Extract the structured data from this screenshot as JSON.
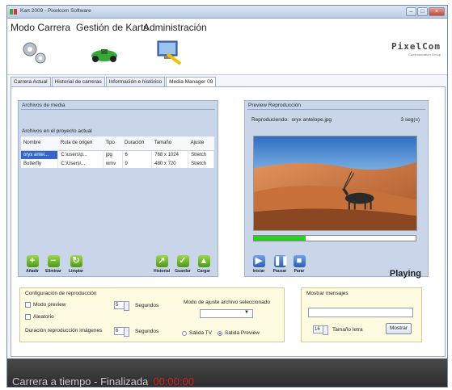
{
  "window": {
    "title": "Kart 2009 - Pixelcom Software",
    "brand": "PixelCom",
    "brand_sub": "Communication Group"
  },
  "ribbon": {
    "tabs": [
      "Modo Carrera",
      "Gestión de Karts",
      "Administración"
    ]
  },
  "tabs": [
    "Carrera Actual",
    "Historial de carreras",
    "Información e histórico",
    "Media Manager 09"
  ],
  "media": {
    "panel_title": "Archivos de media",
    "subtitle": "Archivos en el proyecto actual",
    "columns": [
      "Nombre",
      "Ruta de origen",
      "Tipo",
      "Duración",
      "Tamaño",
      "Ajuste"
    ],
    "rows": [
      [
        "oryx antel...",
        "C:\\users\\p...",
        "jpg",
        "6",
        "768 x 1024",
        "Stretch"
      ],
      [
        "Butterfly",
        "C:\\Users\\...",
        "wmv",
        "9",
        "480 x 720",
        "Stretch"
      ]
    ],
    "buttons": {
      "add": "Añadir",
      "delete": "Eliminar",
      "clear": "Limpiar",
      "history": "Historial",
      "save": "Guardar",
      "load": "Cargar"
    }
  },
  "preview": {
    "panel_title": "Preview Reproducción",
    "playing_label": "Reproduciendo:",
    "file": "oryx antelope.jpg",
    "seconds": "3 seg(s)",
    "progress": 0.32,
    "buttons": {
      "start": "Iniciar",
      "pause": "Pausar",
      "stop": "Parar"
    },
    "status": "Playing"
  },
  "config": {
    "title": "Configuración de reproducción",
    "preview_mode": "Modo preview",
    "preview_secs": "5",
    "seconds_label": "Segundos",
    "random": "Aleatorio",
    "image_duration": "Duración reproducción imágenes",
    "image_secs": "6",
    "fit_mode": "Modo de ajuste archivo seleccionado",
    "output_tv": "Salida TV",
    "output_preview": "Salida Preview"
  },
  "messages": {
    "title": "Mostrar mensajes",
    "font_size": "16",
    "font_label": "Tamaño letra",
    "show_button": "Mostrar"
  },
  "status": {
    "text": "Carrera a tiempo - Finalizada",
    "time": "00:00:00"
  },
  "colors": {
    "accent": "#3366cc",
    "progress": "#2fcb2b",
    "status_time": "#d62020"
  }
}
